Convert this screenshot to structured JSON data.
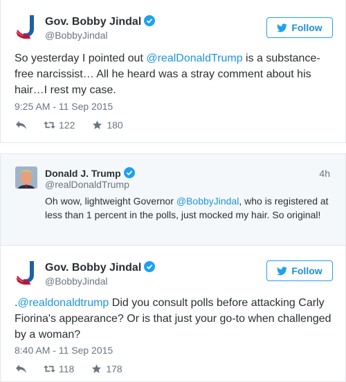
{
  "tweet1": {
    "name": "Gov. Bobby Jindal",
    "handle": "@BobbyJindal",
    "follow_label": "Follow",
    "text_before": "So yesterday I pointed out ",
    "mention": "@realDonaldTrump",
    "text_after": " is a substance-free narcissist… All he heard was a stray comment about his hair…I rest my case.",
    "timestamp": "9:25 AM - 11 Sep 2015",
    "retweets": "122",
    "likes": "180"
  },
  "quote": {
    "name": "Donald J. Trump",
    "handle": "@realDonaldTrump",
    "time": "4h",
    "text_before": "Oh wow, lightweight Governor ",
    "mention": "@BobbyJindal",
    "text_after": ", who is registered at less than 1 percent in the polls, just mocked my hair. So original!"
  },
  "tweet2": {
    "name": "Gov. Bobby Jindal",
    "handle": "@BobbyJindal",
    "follow_label": "Follow",
    "text_prefix": ".",
    "mention": "@realdonaldtrump",
    "text_after": " Did you consult polls before attacking Carly Fiorina's appearance? Or is that just your go-to when challenged by a woman?",
    "timestamp": "8:40 AM - 11 Sep 2015",
    "retweets": "118",
    "likes": "178"
  },
  "colors": {
    "accent": "#1da1f2",
    "link": "#1b95e0",
    "muted": "#66757f"
  },
  "icons": [
    "jindal-logo-icon",
    "verified-icon",
    "twitter-bird-icon",
    "reply-icon",
    "retweet-icon",
    "star-icon"
  ]
}
